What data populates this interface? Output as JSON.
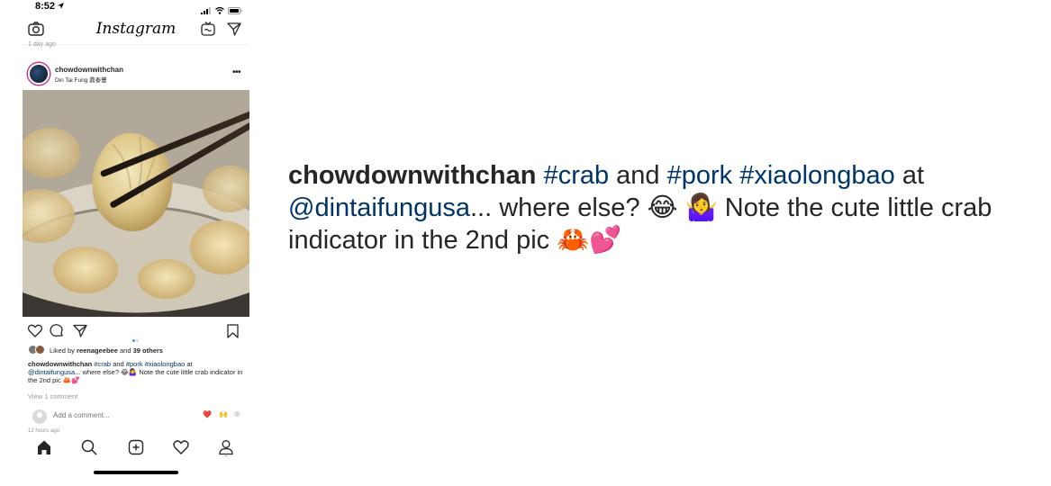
{
  "status_bar": {
    "time": "8:52"
  },
  "header": {
    "logo": "Instagram",
    "icons": [
      "camera-icon",
      "igtv-icon",
      "direct-message-icon"
    ]
  },
  "feed": {
    "previous_post_time": "1 day ago"
  },
  "post": {
    "username": "chowdownwithchan",
    "location": "Din Tai Fung 鼎泰豐",
    "carousel": {
      "slides": 2,
      "active": 1,
      "active_color": "#3897f0",
      "inactive_color": "#dbdbdb"
    },
    "likes": {
      "prefix": "Liked by",
      "user": "reenageebee",
      "middle": "and",
      "others": "39 others"
    },
    "caption": {
      "username": "chowdownwithchan",
      "parts": {
        "tag_crab": "#crab",
        "and": "and",
        "tag_pork": "#pork",
        "tag_xlb": "#xiaolongbao",
        "at": "at",
        "mention": "@dintaifungusa",
        "where_else": "... where else?",
        "emoji_laugh": "😂",
        "emoji_shrug": "🤷‍♀️",
        "note": "Note the cute little crab indicator in the 2nd pic",
        "emoji_crab": "🦀",
        "emoji_hearts": "💕"
      }
    },
    "view_comments": "View 1 comment",
    "add_comment_placeholder": "Add a comment...",
    "quick_reactions": [
      "❤️",
      "🙌"
    ],
    "timestamp": "12 hours ago"
  },
  "tab_bar": {
    "tabs": [
      "home-icon",
      "search-icon",
      "new-post-icon",
      "activity-icon",
      "profile-icon"
    ]
  },
  "colors": {
    "hashtag": "#003569",
    "text": "#262626",
    "muted": "#999999",
    "story_ring": "#c13584"
  }
}
